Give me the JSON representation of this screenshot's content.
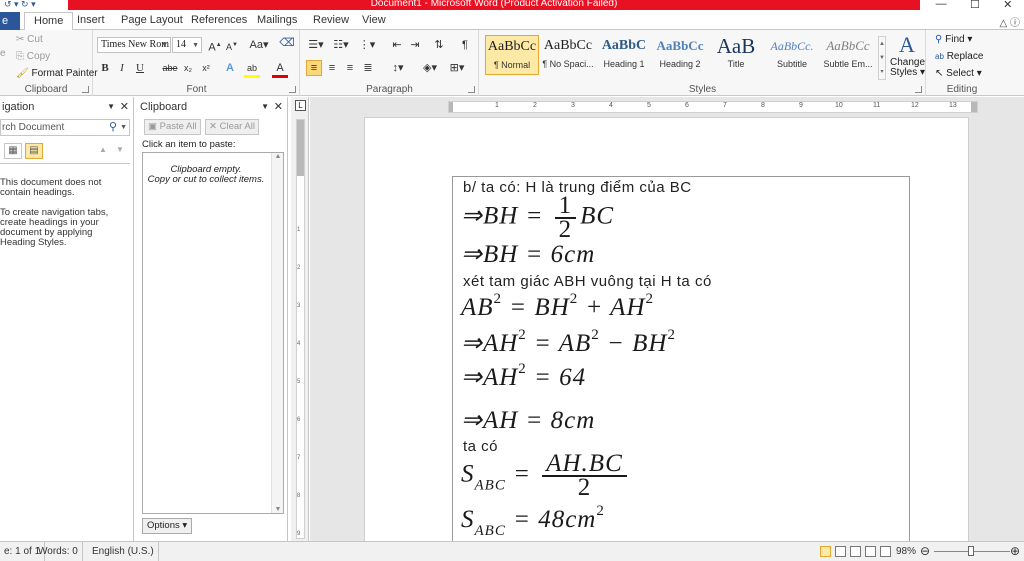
{
  "title_bar": {
    "text": "Document1 - Microsoft Word (Product Activation Failed)",
    "accent": "#e81123"
  },
  "tabs": {
    "file": "e",
    "items": [
      "Home",
      "Insert",
      "Page Layout",
      "References",
      "Mailings",
      "Review",
      "View"
    ],
    "active": "Home"
  },
  "ribbon": {
    "clipboard": {
      "label": "Clipboard",
      "cut": "Cut",
      "copy": "Copy",
      "format_painter": "Format Painter",
      "paste_icon": "e"
    },
    "font": {
      "label": "Font",
      "family": "Times New Rom",
      "size": "14",
      "grow": "A",
      "shrink": "A",
      "change_case": "Aa",
      "bold": "B",
      "italic": "I",
      "underline": "U",
      "strike": "abe",
      "subscript": "x₂",
      "superscript": "x²",
      "text_effects": "A",
      "highlight": "ab",
      "font_color": "A"
    },
    "paragraph": {
      "label": "Paragraph"
    },
    "styles": {
      "label": "Styles",
      "items": [
        {
          "sample": "AaBbCc",
          "name": "¶ Normal"
        },
        {
          "sample": "AaBbCc",
          "name": "¶ No Spaci..."
        },
        {
          "sample": "AaBbC",
          "name": "Heading 1"
        },
        {
          "sample": "AaBbCc",
          "name": "Heading 2"
        },
        {
          "sample": "AaB",
          "name": "Title"
        },
        {
          "sample": "AaBbCc.",
          "name": "Subtitle"
        },
        {
          "sample": "AaBbCc",
          "name": "Subtle Em..."
        }
      ],
      "change_styles": "Change Styles",
      "change_styles_line1": "Change",
      "change_styles_line2": "Styles"
    },
    "editing": {
      "label": "Editing",
      "find": "Find",
      "replace": "Replace",
      "select": "Select"
    }
  },
  "navigation_pane": {
    "title": "igation",
    "search_placeholder": "rch Document",
    "message1": "This document does not contain headings.",
    "message2": "To create navigation tabs, create headings in your document by applying Heading Styles."
  },
  "clipboard_pane": {
    "title": "Clipboard",
    "paste_all": "Paste All",
    "clear_all": "Clear All",
    "hint": "Click an item to paste:",
    "empty_line1": "Clipboard empty.",
    "empty_line2": "Copy or cut to collect items.",
    "options": "Options"
  },
  "document": {
    "lines": {
      "l1": "b/ ta có: H là trung điểm của BC",
      "l2_pre": "⇒BH = ",
      "l2_num": "1",
      "l2_den": "2",
      "l2_post": "BC",
      "l3": "⇒BH = 6cm",
      "l4": "xét tam giác ABH vuông tại H ta có",
      "l5_a": "AB",
      "l5_b": " = BH",
      "l5_c": " + AH",
      "sq": "2",
      "l6_a": "⇒AH",
      "l6_b": " = AB",
      "l6_c": " − BH",
      "l7_a": "⇒AH",
      "l7_b": " = 64",
      "l8": "⇒AH = 8cm",
      "l9": "ta có",
      "l10_s": "S",
      "l10_sub": "ABC",
      "l10_eq": " = ",
      "l10_num": "AH.BC",
      "l10_den": "2",
      "l11_s": "S",
      "l11_sub": "ABC",
      "l11_eq": " = 48cm"
    }
  },
  "status_bar": {
    "page": "e: 1 of 1",
    "words": "Words: 0",
    "language": "English (U.S.)",
    "zoom": "98%",
    "zoom_value": 98
  }
}
